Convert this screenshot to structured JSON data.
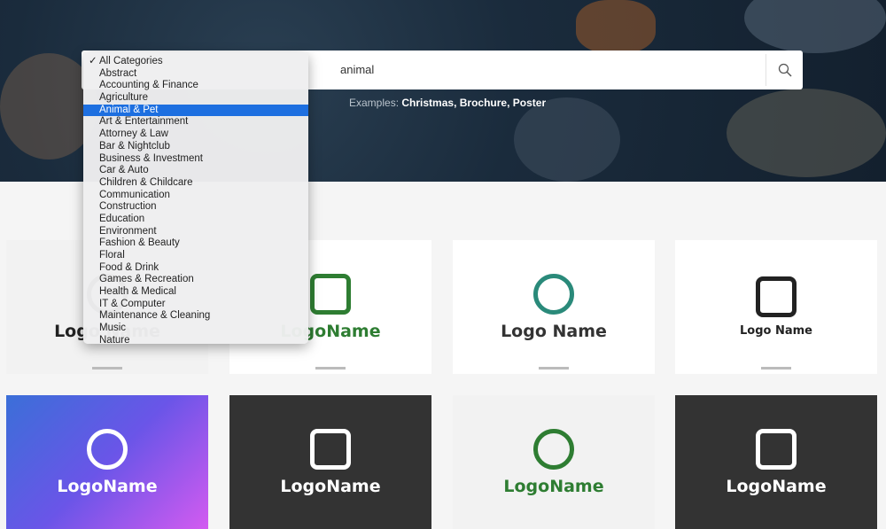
{
  "search": {
    "query": "animal",
    "category_selected": "All Categories"
  },
  "examples": {
    "label": "Examples:",
    "items": [
      "Christmas,",
      "Brochure,",
      "Poster"
    ]
  },
  "dropdown": {
    "options": [
      "All Categories",
      "Abstract",
      "Accounting & Finance",
      "Agriculture",
      "Animal & Pet",
      "Art & Entertainment",
      "Attorney & Law",
      "Bar & Nightclub",
      "Business & Investment",
      "Car & Auto",
      "Children & Childcare",
      "Communication",
      "Construction",
      "Education",
      "Environment",
      "Fashion & Beauty",
      "Floral",
      "Food & Drink",
      "Games & Recreation",
      "Health & Medical",
      "IT & Computer",
      "Maintenance & Cleaning",
      "Music",
      "Nature"
    ],
    "checked": "All Categories",
    "highlighted": "Animal & Pet",
    "highlight_color": "#1d6fe0"
  },
  "cards": [
    {
      "text": "Logo Name",
      "bg": "#f2f2f2",
      "color": "#222"
    },
    {
      "text": "LogoName",
      "bg": "#ffffff",
      "color": "#2e7d32"
    },
    {
      "text": "Logo Name",
      "bg": "#ffffff",
      "color": "#333",
      "accent": "#2a8a7a"
    },
    {
      "text": "Logo Name",
      "bg": "#ffffff",
      "color": "#222"
    },
    {
      "text": "LogoName",
      "bg": "gradient",
      "color": "#fff"
    },
    {
      "text": "LogoName",
      "bg": "#333333",
      "color": "#fff"
    },
    {
      "text": "LogoName",
      "bg": "#f2f2f2",
      "color": "#2e7d32"
    },
    {
      "text": "LogoName",
      "bg": "#333333",
      "color": "#fff"
    }
  ]
}
